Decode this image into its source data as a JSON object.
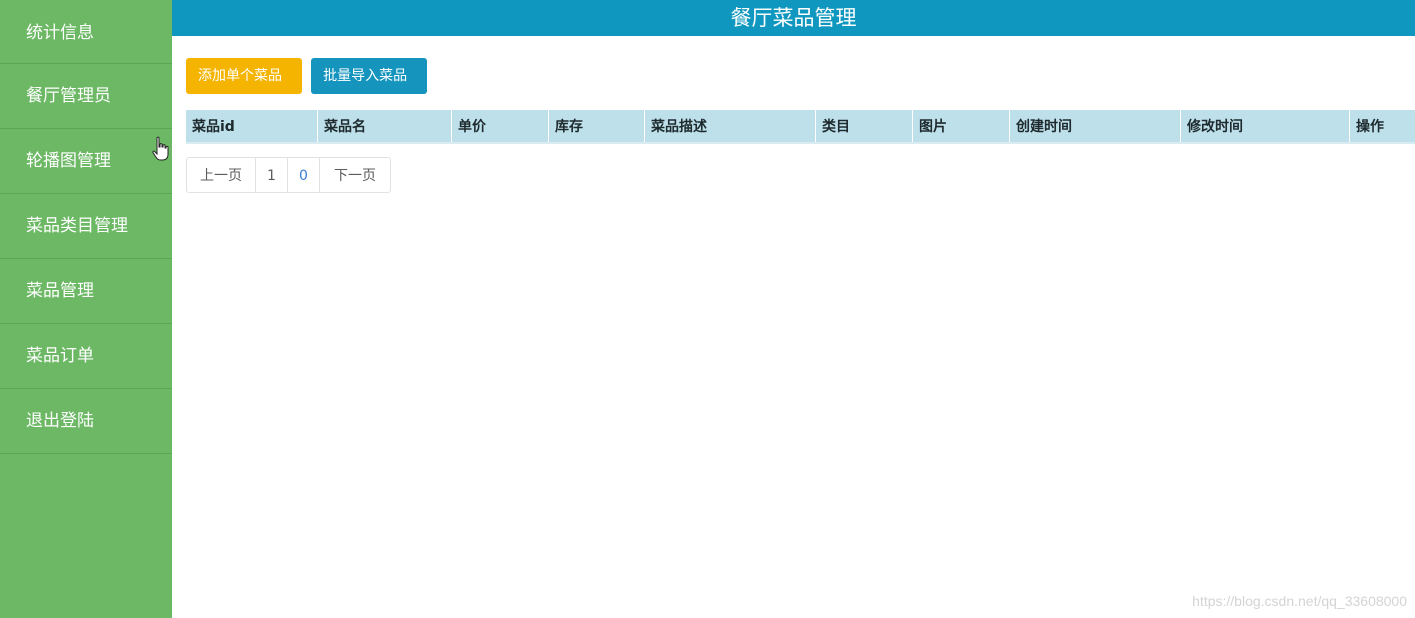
{
  "header": {
    "title": "餐厅菜品管理"
  },
  "sidebar": {
    "items": [
      {
        "label": "统计信息"
      },
      {
        "label": "餐厅管理员"
      },
      {
        "label": "轮播图管理"
      },
      {
        "label": "菜品类目管理"
      },
      {
        "label": "菜品管理"
      },
      {
        "label": "菜品订单"
      },
      {
        "label": "退出登陆"
      }
    ]
  },
  "toolbar": {
    "add_label": "添加单个菜品",
    "import_label": "批量导入菜品"
  },
  "table": {
    "columns": [
      "菜品id",
      "菜品名",
      "单价",
      "库存",
      "菜品描述",
      "类目",
      "图片",
      "创建时间",
      "修改时间",
      "操作"
    ],
    "rows": []
  },
  "pagination": {
    "prev": "上一页",
    "current": "1",
    "total": "0",
    "next": "下一页"
  },
  "watermark": "https://blog.csdn.net/qq_33608000",
  "colors": {
    "sidebar": "#6cb865",
    "header": "#0f97bf",
    "add_button": "#f5b400",
    "import_button": "#1594be",
    "table_head": "#bde0ea"
  }
}
